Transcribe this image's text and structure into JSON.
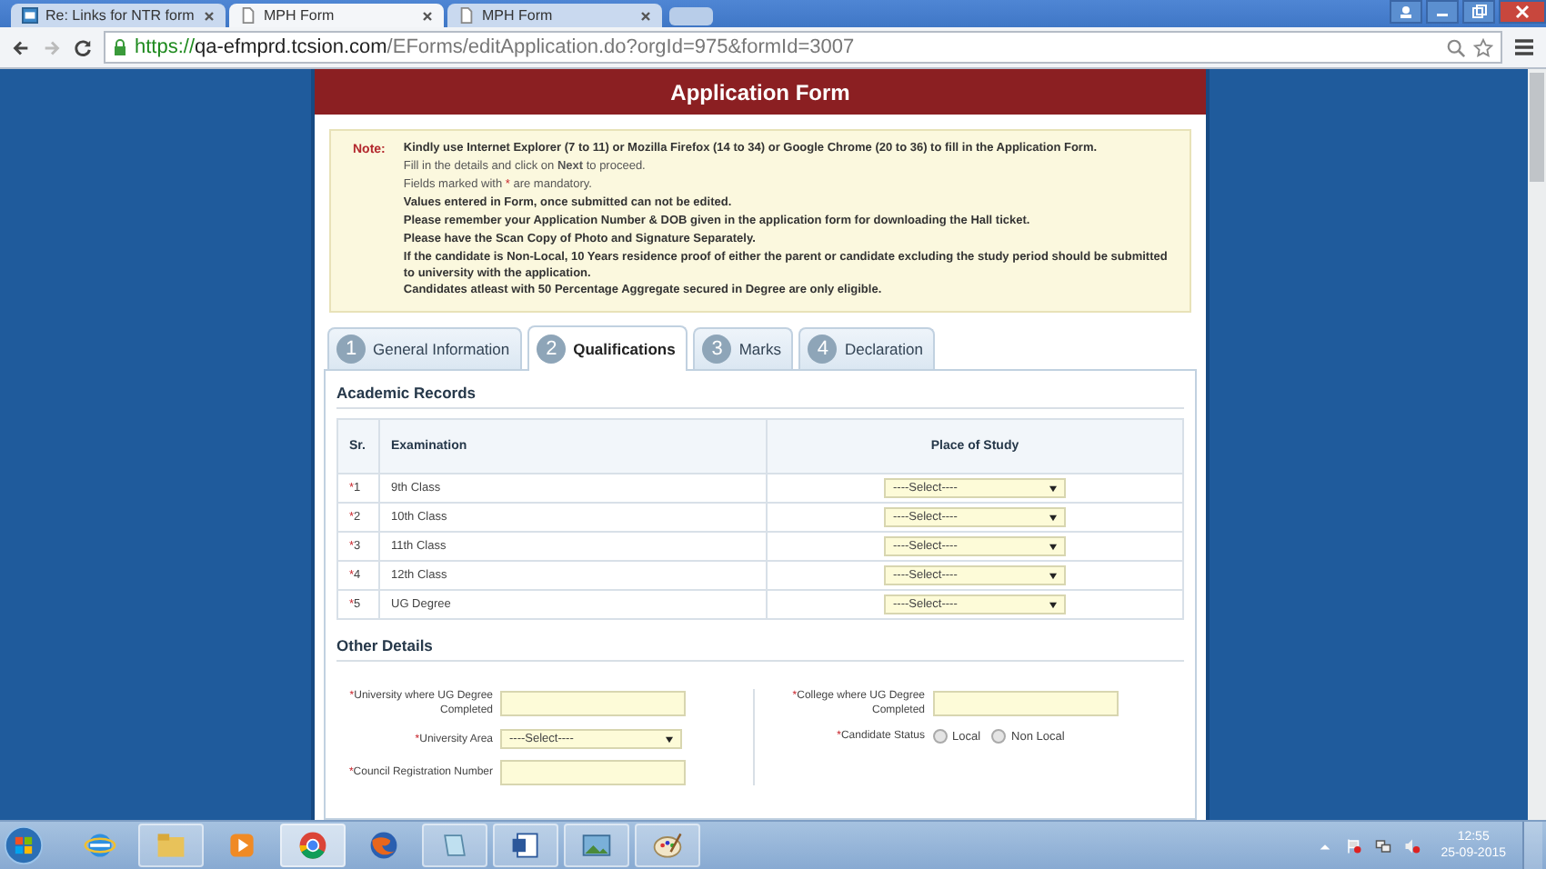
{
  "browser": {
    "tabs": [
      {
        "label": "Re: Links for NTR form",
        "selected": false,
        "kind": "mail"
      },
      {
        "label": "MPH Form",
        "selected": true,
        "kind": "page"
      },
      {
        "label": "MPH Form",
        "selected": false,
        "kind": "page"
      }
    ],
    "url": {
      "scheme": "https://",
      "host": "qa-efmprd.tcsion.com",
      "path": "/EForms/editApplication.do?orgId=975&formId=3007"
    }
  },
  "form": {
    "title": "Application Form",
    "note": {
      "label": "Note:",
      "lines": [
        {
          "text": "Kindly use Internet Explorer (7 to 11) or Mozilla Firefox (14 to 34) or Google Chrome (20 to 36) to fill in the Application Form.",
          "bold": true
        },
        {
          "text": "Fill in the details and click on **Next** to proceed.",
          "bold": false
        },
        {
          "text": "Fields marked with ",
          "asterisk": "*",
          "text_after": " are mandatory.",
          "bold": false
        },
        {
          "text": "Values entered in Form, once submitted can not be edited.",
          "bold": true
        },
        {
          "text": "Please remember your Application Number & DOB given in the application form for downloading the Hall ticket.",
          "bold": true
        },
        {
          "text": "Please have the Scan Copy of Photo and Signature Separately.",
          "bold": true
        },
        {
          "text": "If the candidate is Non-Local, 10 Years residence proof of either the parent or candidate excluding the study period should be submitted to university with the application.",
          "bold": true
        },
        {
          "text": "Candidates atleast with 50 Percentage Aggregate secured in Degree are only eligible.",
          "bold": true
        }
      ]
    },
    "steps": [
      {
        "number": "1",
        "label": "General Information",
        "selected": false
      },
      {
        "number": "2",
        "label": "Qualifications",
        "selected": true
      },
      {
        "number": "3",
        "label": "Marks",
        "selected": false
      },
      {
        "number": "4",
        "label": "Declaration",
        "selected": false
      }
    ],
    "academic_records": {
      "heading": "Academic Records",
      "columns": [
        "Sr.",
        "Examination",
        "Place of Study"
      ],
      "rows": [
        {
          "sr": "1",
          "required": true,
          "examination": "9th Class",
          "place": "----Select----"
        },
        {
          "sr": "2",
          "required": true,
          "examination": "10th Class",
          "place": "----Select----"
        },
        {
          "sr": "3",
          "required": true,
          "examination": "11th Class",
          "place": "----Select----"
        },
        {
          "sr": "4",
          "required": true,
          "examination": "12th Class",
          "place": "----Select----"
        },
        {
          "sr": "5",
          "required": true,
          "examination": "UG Degree",
          "place": "----Select----"
        }
      ]
    },
    "other_details": {
      "heading": "Other Details",
      "left": [
        {
          "kind": "input",
          "label": "University where UG Degree Completed",
          "required": true
        },
        {
          "kind": "select",
          "label": "University Area",
          "required": true,
          "value": "----Select----"
        },
        {
          "kind": "input",
          "label": "Council Registration Number",
          "required": true
        }
      ],
      "right": [
        {
          "kind": "input",
          "label": "College where UG Degree Completed",
          "required": true
        },
        {
          "kind": "radio",
          "label": "Candidate Status",
          "required": true,
          "options": [
            {
              "label": "Local",
              "selected": false
            },
            {
              "label": "Non Local",
              "selected": false
            }
          ]
        }
      ]
    }
  },
  "taskbar": {
    "apps": [
      {
        "kind": "ie"
      },
      {
        "kind": "folder"
      },
      {
        "kind": "media"
      },
      {
        "kind": "chrome",
        "selected": true
      },
      {
        "kind": "firefox"
      },
      {
        "kind": "notepad"
      },
      {
        "kind": "word"
      },
      {
        "kind": "photo"
      },
      {
        "kind": "paint"
      }
    ],
    "time": "12:55",
    "date": "25-09-2015"
  }
}
